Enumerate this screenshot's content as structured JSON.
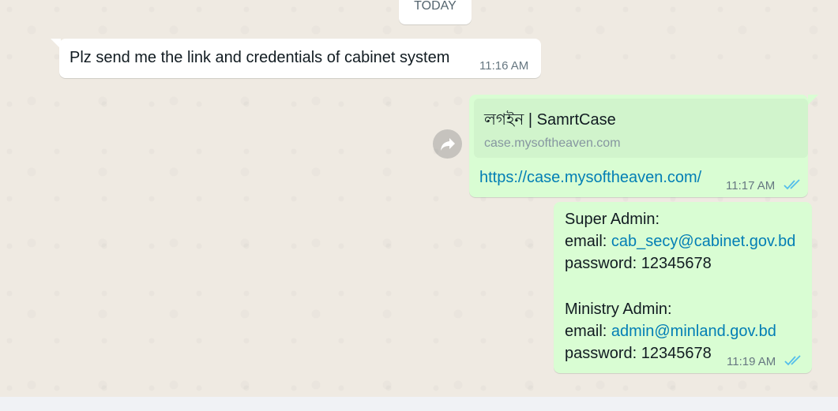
{
  "date_chip": "TODAY",
  "messages": {
    "m1": {
      "text": "Plz send me the link and credentials of cabinet system",
      "time": "11:16 AM"
    },
    "m2": {
      "preview_title": "লগইন | SamrtCase",
      "preview_domain": "case.mysoftheaven.com",
      "url": "https://case.mysoftheaven.com/",
      "time": "11:17 AM",
      "status": "read"
    },
    "m3": {
      "super_admin_heading": "Super Admin:",
      "email_label": "email: ",
      "super_admin_email": "cab_secy@cabinet.gov.bd",
      "super_admin_password": "password: 12345678",
      "ministry_admin_heading": "Ministry Admin:",
      "ministry_admin_email": "admin@minland.gov.bd",
      "ministry_admin_password": "password: 12345678",
      "time": "11:19 AM",
      "status": "read"
    }
  },
  "icons": {
    "forward": "forward-arrow-icon",
    "read_ticks": "double-check-icon"
  },
  "colors": {
    "background": "#efeae2",
    "incoming_bubble": "#ffffff",
    "outgoing_bubble": "#d9fdd3",
    "link": "#027eb5",
    "read_ticks": "#53bdeb"
  }
}
